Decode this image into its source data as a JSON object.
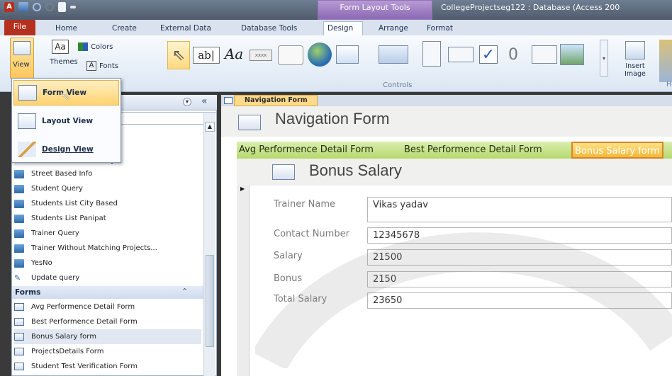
{
  "titlebar": {
    "app_icon": "A",
    "context_tab_group": "Form Layout Tools",
    "window_title": "CollegeProjectseg122 : Database (Access 200"
  },
  "ribbon_tabs": [
    "File",
    "Home",
    "Create",
    "External Data",
    "Database Tools",
    "Design",
    "Arrange",
    "Format"
  ],
  "ribbon": {
    "view_label": "View",
    "themes_label": "Themes",
    "colors_label": "Colors",
    "fonts_label": "Fonts",
    "controls_group_label": "Controls",
    "insert_image_label": "Insert Image",
    "text_box_glyph": "ab|",
    "label_glyph": "Aa",
    "button_glyph": "xxxx",
    "themes_glyph": "Aa",
    "fonts_glyph": "A",
    "overflow_glyph": "H",
    "accent_color": "#b3301f"
  },
  "view_menu": {
    "items": [
      "Form View",
      "Layout View",
      "Design View"
    ]
  },
  "nav_pane": {
    "partial_item_suffix": "ry",
    "query_items": [
      "Street Based Info",
      "Student Query",
      "Students List City Based",
      "Students List Panipat",
      "Trainer Query",
      "Trainer Without Matching Projects...",
      "YesNo",
      "Update query"
    ],
    "forms_header": "Forms",
    "form_items": [
      "Avg Performence Detail Form",
      "Best Performence Detail Form",
      "Bonus Salary form",
      "ProjectsDetails Form",
      "Student Test Verification Form"
    ],
    "collapse_glyph": "«",
    "chevron_glyph": "⌃"
  },
  "document": {
    "tab_label": "Navigation Form",
    "form_title": "Navigation Form",
    "nav_tabs": [
      "Avg Performence Detail Form",
      "Best Performence Detail Form",
      "Bonus Salary form"
    ],
    "subform_title": "Bonus Salary",
    "record_selector_glyph": "▶",
    "fields": [
      {
        "label": "Trainer Name",
        "value": "Vikas yadav"
      },
      {
        "label": "Contact Number",
        "value": "12345678"
      },
      {
        "label": "Salary",
        "value": "21500"
      },
      {
        "label": "Bonus",
        "value": "2150"
      },
      {
        "label": "Total Salary",
        "value": "23650"
      }
    ]
  }
}
